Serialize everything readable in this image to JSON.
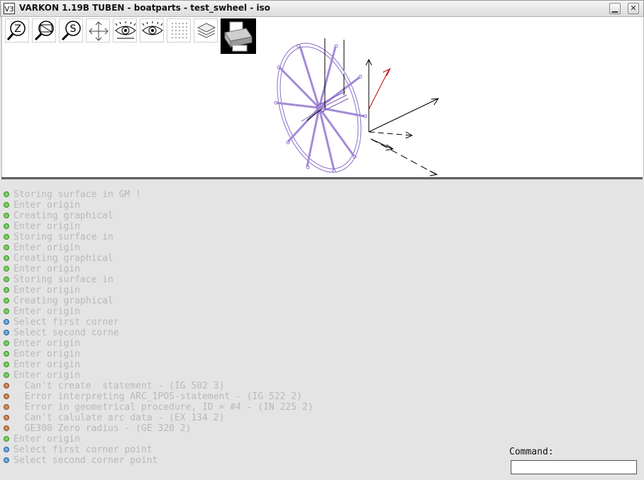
{
  "window": {
    "title": "VARKON 1.19B TUBEN - boatparts - test_swheel - iso",
    "logo_text": "V3",
    "min_glyph": "▁",
    "close_glyph": "✕"
  },
  "toolbar": {
    "zoom_letter": "Z",
    "scale_letter": "S",
    "tools": [
      "zoom-icon",
      "zoom-window-icon",
      "scale-icon",
      "pan-icon",
      "eye-view-icon",
      "eye-perspective-icon",
      "grid-icon",
      "layers-icon",
      "printer-icon"
    ]
  },
  "colors": {
    "model_line": "#8a6fc8",
    "axis": "#000000",
    "axis_red": "#c00000"
  },
  "log": [
    {
      "kind": "info",
      "text": "Storing surface in GM !"
    },
    {
      "kind": "info",
      "text": "Enter origin"
    },
    {
      "kind": "info",
      "text": "Creating graphical"
    },
    {
      "kind": "info",
      "text": "Enter origin"
    },
    {
      "kind": "info",
      "text": "Storing surface in"
    },
    {
      "kind": "info",
      "text": "Enter origin"
    },
    {
      "kind": "info",
      "text": "Creating graphical"
    },
    {
      "kind": "info",
      "text": "Enter origin"
    },
    {
      "kind": "info",
      "text": "Storing surface in"
    },
    {
      "kind": "info",
      "text": "Enter origin"
    },
    {
      "kind": "info",
      "text": "Creating graphical"
    },
    {
      "kind": "info",
      "text": "Enter origin"
    },
    {
      "kind": "prompt",
      "text": "Select first corner"
    },
    {
      "kind": "prompt",
      "text": "Select second corne"
    },
    {
      "kind": "info",
      "text": "Enter origin"
    },
    {
      "kind": "info",
      "text": "Enter origin"
    },
    {
      "kind": "info",
      "text": "Enter origin"
    },
    {
      "kind": "info",
      "text": "Enter origin"
    },
    {
      "kind": "error",
      "text": "  Can't create  statement - (IG 502 3)"
    },
    {
      "kind": "error",
      "text": "  Error interpreting ARC_1POS-statement - (IG 522 2)"
    },
    {
      "kind": "error",
      "text": "  Error in geometrical procedure, ID = #4 - (IN 225 2)"
    },
    {
      "kind": "error",
      "text": "  Can't calulate arc data - (EX 134 2)"
    },
    {
      "kind": "error",
      "text": "  GE300 Zero radius - (GE 320 2)"
    },
    {
      "kind": "info",
      "text": "Enter origin"
    },
    {
      "kind": "prompt",
      "text": "Select first corner point"
    },
    {
      "kind": "prompt",
      "text": "Select second corner point"
    }
  ],
  "command": {
    "label": "Command:",
    "value": ""
  }
}
